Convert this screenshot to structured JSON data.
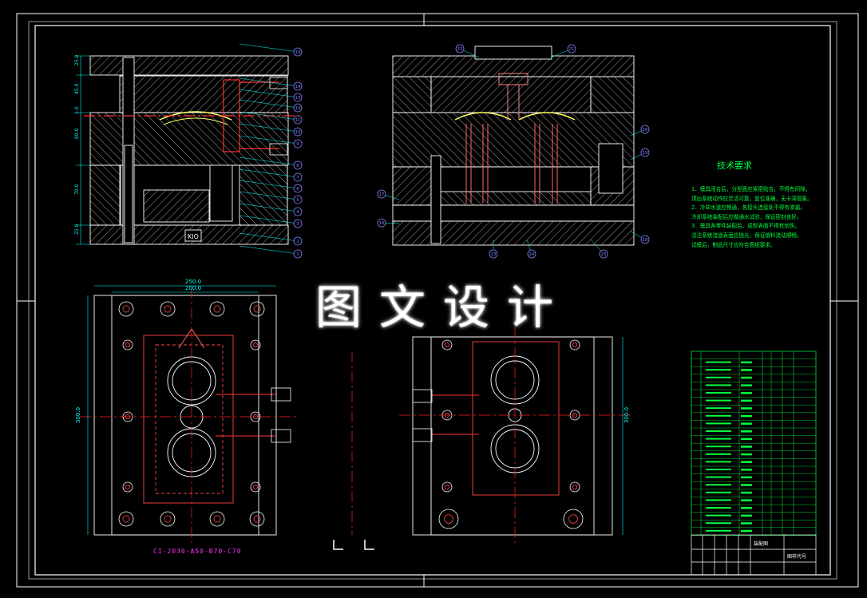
{
  "watermark": "图文设计",
  "technical_requirements": {
    "title": "技术要求",
    "lines": [
      "1．模具闭合后，分型面应紧密贴合，不得有间隙。",
      "顶出系统动作应灵活可靠，复位准确，无卡滞现象。",
      "2．冷却水道应畅通，各接头连接处不得有渗漏。",
      "冷却系统装配后应做通水试验，保证密封良好。",
      "3．模具各零件装配后，成型表面不得有划伤。",
      "浇注系统流道表面应抛光，保证熔料流动顺畅。",
      "试模后，制品尺寸应符合图纸要求。"
    ]
  },
  "model_code": "CI-2030-A50-B70-C70",
  "dimensions": {
    "plan_width_outer": "250.0",
    "plan_width_inner": "200.0",
    "plan_height": "300.0",
    "right_height": "300.0",
    "left_section_dims": [
      "25.0",
      "45.0",
      "1.0",
      "60.0",
      "70.0",
      "25.0"
    ]
  },
  "balloons_left": [
    "15",
    "14",
    "13",
    "12",
    "11",
    "10",
    "9",
    "8",
    "7",
    "6",
    "5",
    "4",
    "3",
    "2",
    "1"
  ],
  "balloons_right": [
    "22",
    "21",
    "20",
    "19",
    "18",
    "17",
    "16",
    "23",
    "24",
    "25"
  ],
  "title_block": {
    "name": "装配图",
    "drawing_code": "图样代号",
    "company": "",
    "material": ""
  },
  "bom_rows": 24,
  "colors": {
    "background": "#000000",
    "frame": "#ffffff",
    "outline": "#ffffff",
    "hatch": "#ffffff",
    "center_line": "#ff2020",
    "dimension": "#00ffff",
    "cooling": "#ff3333",
    "balloon": "#8080ff",
    "ejector": "#ff8080",
    "bom_text": "#00ff40",
    "accent": "#ffff00",
    "magenta": "#ff33ff"
  }
}
